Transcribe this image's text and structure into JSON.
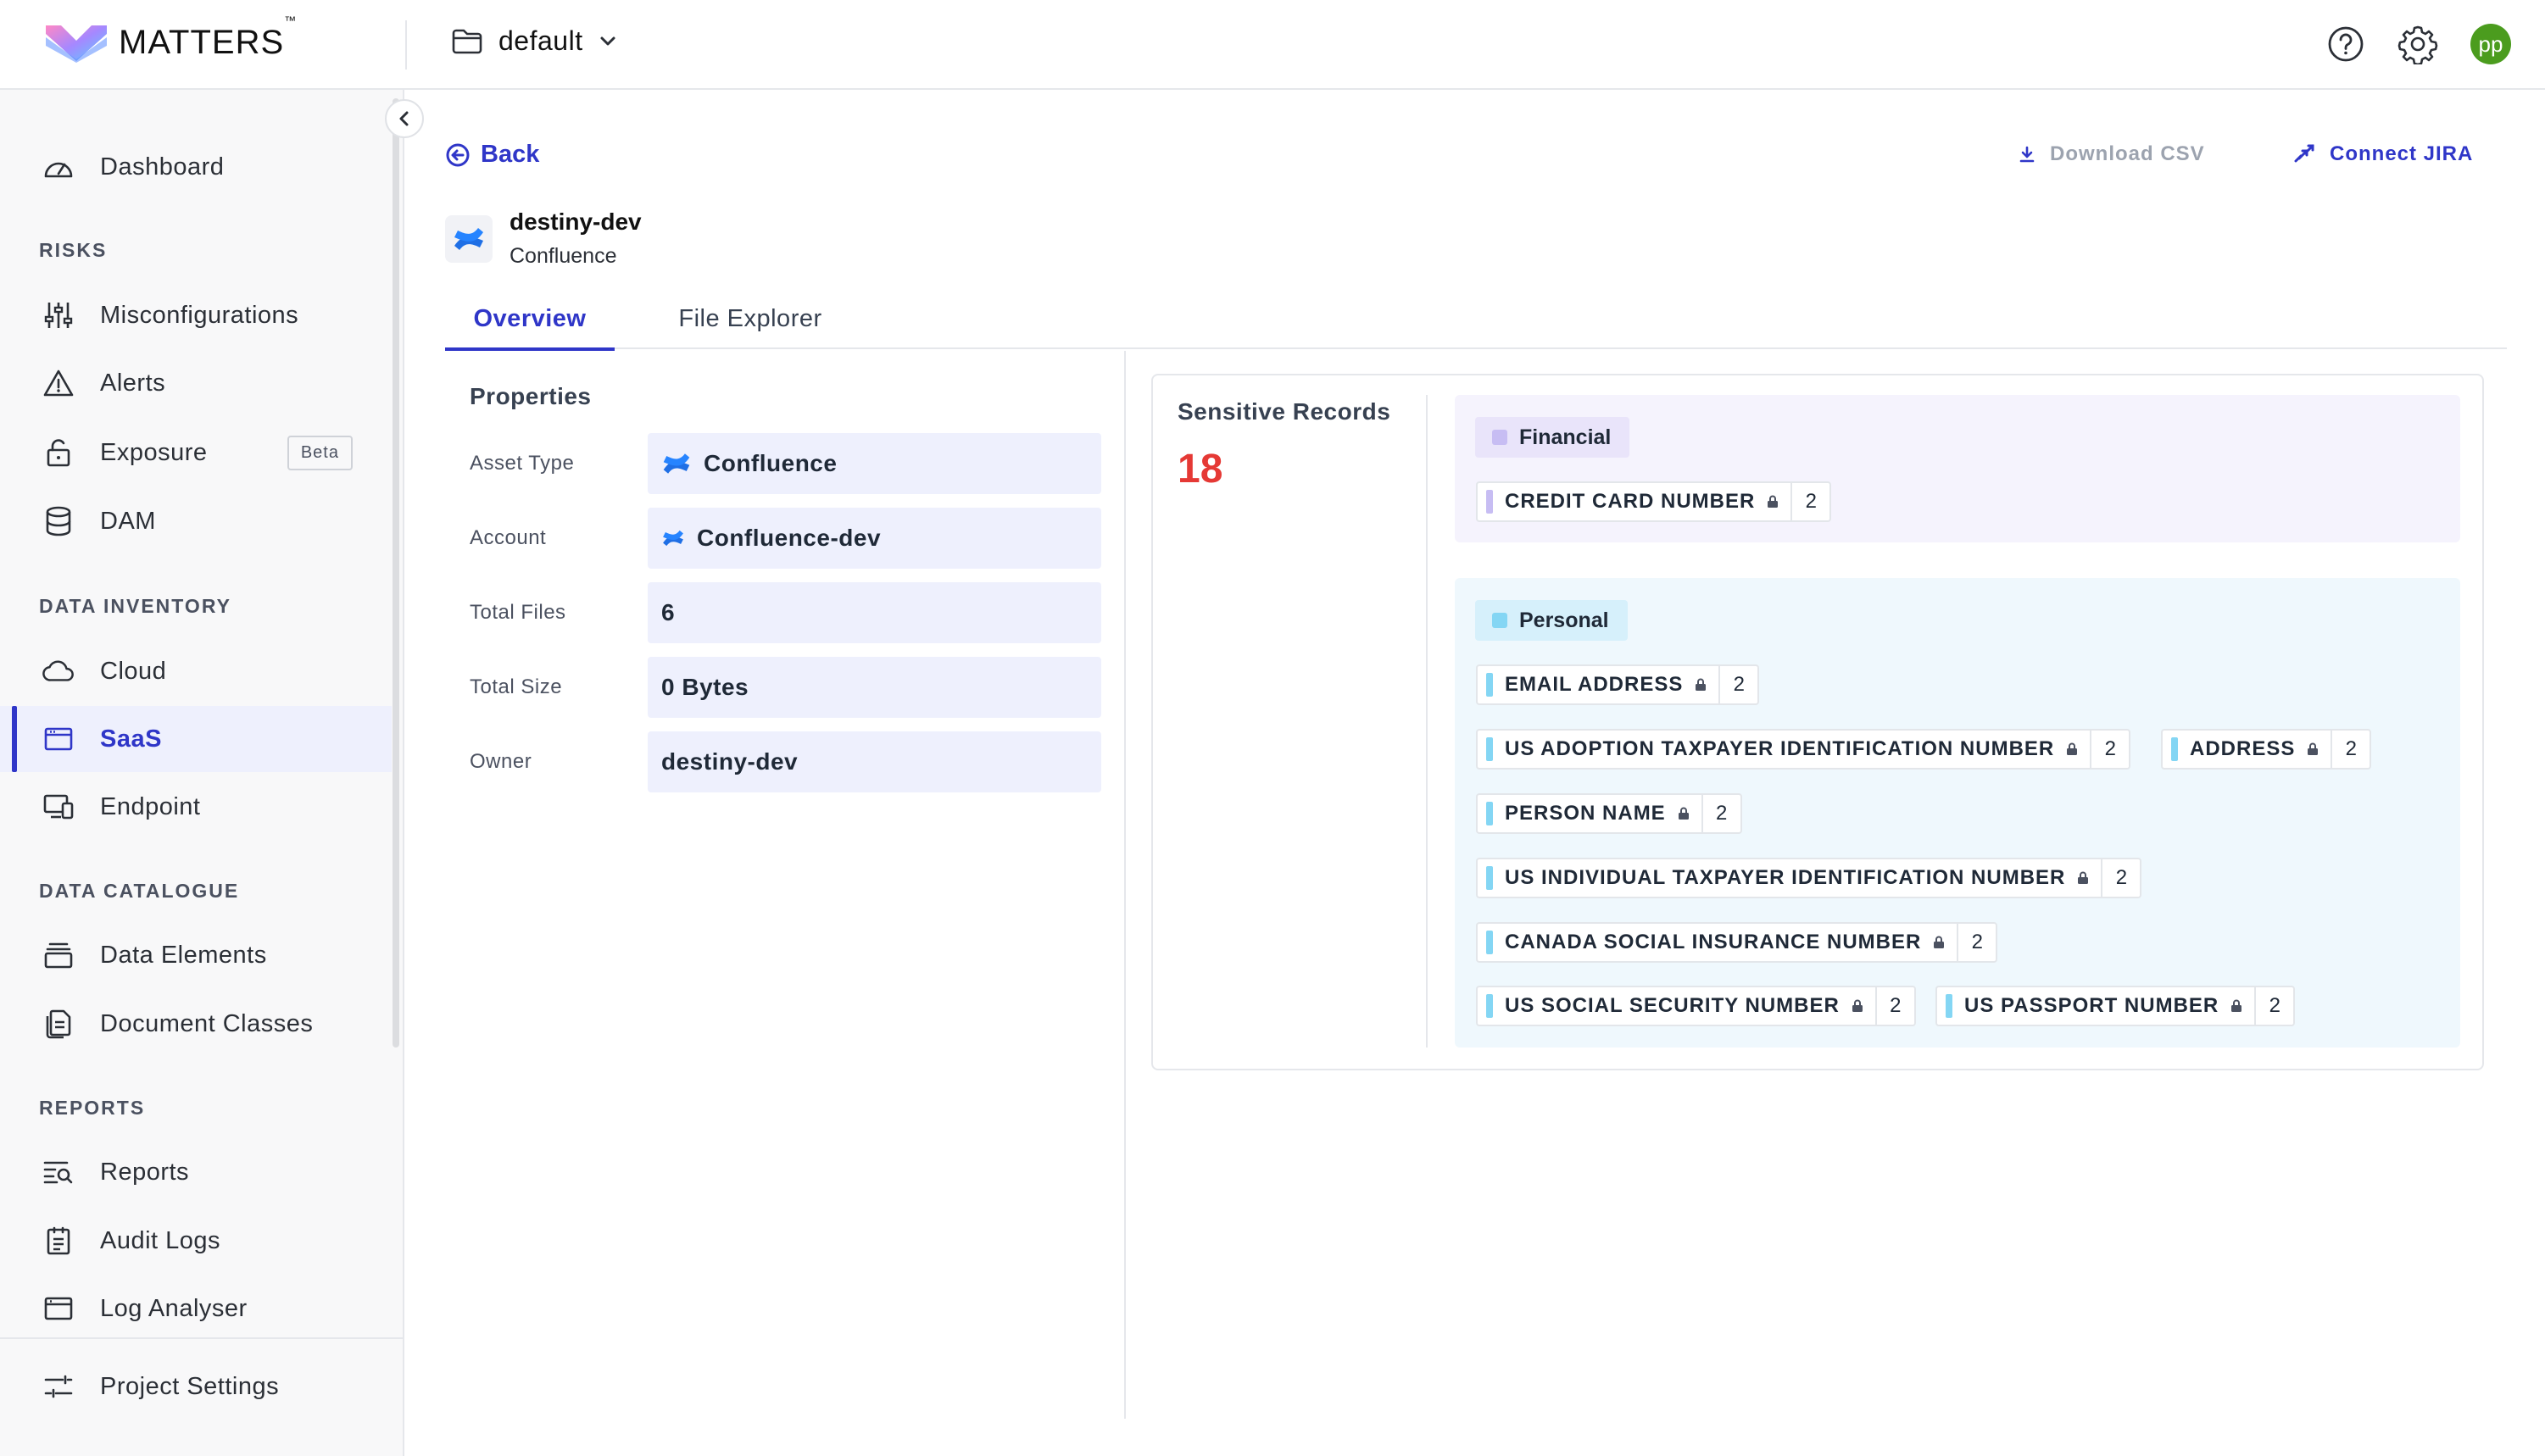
{
  "app": {
    "logo_text": "MATTERS",
    "logo_tm": "™",
    "project": "default",
    "avatar_initials": "pp",
    "avatar_color": "#4b9c1e",
    "accent_color": "#2f36c8"
  },
  "sidebar": {
    "dashboard": "Dashboard",
    "sections": {
      "risks": "RISKS",
      "data_inventory": "DATA INVENTORY",
      "data_catalogue": "DATA CATALOGUE",
      "reports": "REPORTS"
    },
    "misconfigurations": "Misconfigurations",
    "alerts": "Alerts",
    "exposure": "Exposure",
    "exposure_badge": "Beta",
    "dam": "DAM",
    "cloud": "Cloud",
    "saas": "SaaS",
    "endpoint": "Endpoint",
    "data_elements": "Data Elements",
    "document_classes": "Document Classes",
    "reports": "Reports",
    "audit_logs": "Audit Logs",
    "log_analyser": "Log Analyser",
    "project_settings": "Project Settings"
  },
  "header": {
    "back_label": "Back",
    "download_csv_label": "Download CSV",
    "connect_jira_label": "Connect JIRA"
  },
  "asset": {
    "name": "destiny-dev",
    "type": "Confluence"
  },
  "tabs": {
    "overview": "Overview",
    "file_explorer": "File Explorer"
  },
  "properties": {
    "title": "Properties",
    "rows": [
      {
        "label": "Asset Type",
        "value": "Confluence"
      },
      {
        "label": "Account",
        "value": "Confluence-dev"
      },
      {
        "label": "Total Files",
        "value": "6"
      },
      {
        "label": "Total Size",
        "value": "0 Bytes"
      },
      {
        "label": "Owner",
        "value": "destiny-dev"
      }
    ]
  },
  "sensitive": {
    "title": "Sensitive Records",
    "count": "18",
    "count_color": "#e53935",
    "financial": {
      "label": "Financial",
      "color": "#c7bdf3",
      "items": [
        {
          "label": "CREDIT CARD NUMBER",
          "count": "2"
        }
      ]
    },
    "personal": {
      "label": "Personal",
      "color": "#84d6f4",
      "items": [
        {
          "label": "EMAIL ADDRESS",
          "count": "2"
        },
        {
          "label": "US ADOPTION TAXPAYER IDENTIFICATION NUMBER",
          "count": "2"
        },
        {
          "label": "ADDRESS",
          "count": "2"
        },
        {
          "label": "PERSON NAME",
          "count": "2"
        },
        {
          "label": "US INDIVIDUAL TAXPAYER IDENTIFICATION NUMBER",
          "count": "2"
        },
        {
          "label": "CANADA SOCIAL INSURANCE NUMBER",
          "count": "2"
        },
        {
          "label": "US SOCIAL SECURITY NUMBER",
          "count": "2"
        },
        {
          "label": "US PASSPORT NUMBER",
          "count": "2"
        }
      ]
    }
  }
}
